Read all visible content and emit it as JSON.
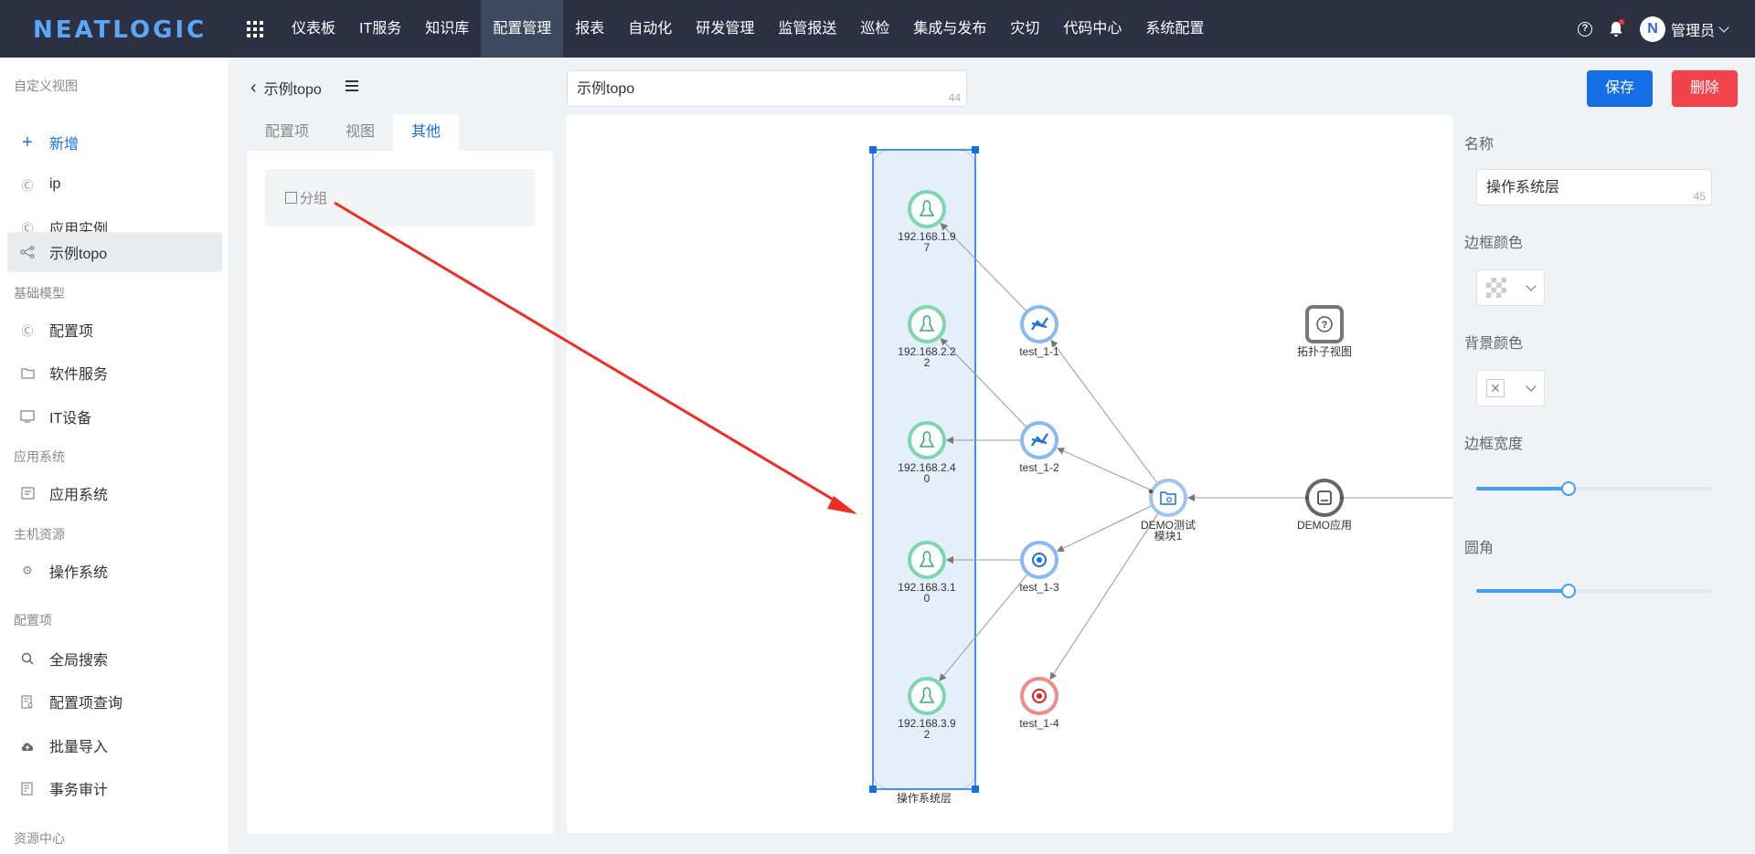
{
  "app": {
    "logo": "NEATLOGIC"
  },
  "nav": [
    "仪表板",
    "IT服务",
    "知识库",
    "配置管理",
    "报表",
    "自动化",
    "研发管理",
    "监管报送",
    "巡检",
    "集成与发布",
    "灾切",
    "代码中心",
    "系统配置"
  ],
  "nav_active": 3,
  "user": {
    "name": "管理员",
    "avatar_letter": "N"
  },
  "sidebar": {
    "groups": [
      "自定义视图",
      "基础模型",
      "应用系统",
      "主机资源",
      "配置项",
      "资源中心"
    ],
    "items": [
      {
        "label": "新增",
        "icon": "plus-icon"
      },
      {
        "label": "ip",
        "icon": "ci-icon"
      },
      {
        "label": "应用实例",
        "icon": "ci-icon"
      },
      {
        "label": "示例topo",
        "icon": "topo-icon"
      },
      {
        "label": "配置项",
        "icon": "ci-icon"
      },
      {
        "label": "软件服务",
        "icon": "folder-icon"
      },
      {
        "label": "IT设备",
        "icon": "device-icon"
      },
      {
        "label": "应用系统",
        "icon": "app-icon"
      },
      {
        "label": "操作系统",
        "icon": "gear-icon"
      },
      {
        "label": "全局搜索",
        "icon": "search-icon"
      },
      {
        "label": "配置项查询",
        "icon": "query-icon"
      },
      {
        "label": "批量导入",
        "icon": "cloud-upload-icon"
      },
      {
        "label": "事务审计",
        "icon": "audit-icon"
      }
    ]
  },
  "breadcrumb": {
    "back": "‹",
    "title": "示例topo"
  },
  "tabs": [
    "配置项",
    "视图",
    "其他"
  ],
  "tab_active": 2,
  "group_option": "分组",
  "view_name": {
    "value": "示例topo",
    "count": "44"
  },
  "buttons": {
    "save": "保存",
    "delete": "删除"
  },
  "topology": {
    "group_label": "操作系统层",
    "nodes": [
      {
        "id": "os1",
        "label": [
          "192.168.1.9",
          "7"
        ],
        "kind": "linux"
      },
      {
        "id": "os2",
        "label": [
          "192.168.2.2",
          "2"
        ],
        "kind": "linux"
      },
      {
        "id": "os3",
        "label": [
          "192.168.2.4",
          "0"
        ],
        "kind": "linux"
      },
      {
        "id": "os4",
        "label": [
          "192.168.3.1",
          "0"
        ],
        "kind": "linux"
      },
      {
        "id": "os5",
        "label": [
          "192.168.3.9",
          "2"
        ],
        "kind": "linux"
      },
      {
        "id": "t11",
        "label": [
          "test_1-1"
        ],
        "kind": "instance"
      },
      {
        "id": "t12",
        "label": [
          "test_1-2"
        ],
        "kind": "instance"
      },
      {
        "id": "t13",
        "label": [
          "test_1-3"
        ],
        "kind": "instance2"
      },
      {
        "id": "t14",
        "label": [
          "test_1-4"
        ],
        "kind": "alert"
      },
      {
        "id": "mod",
        "label": [
          "DEMO测试",
          "模块1"
        ],
        "kind": "module"
      },
      {
        "id": "app",
        "label": [
          "DEMO应用"
        ],
        "kind": "app"
      },
      {
        "id": "sub",
        "label": [
          "拓扑子视图"
        ],
        "kind": "subview"
      }
    ],
    "edges": [
      [
        "t11",
        "os1"
      ],
      [
        "t12",
        "os2"
      ],
      [
        "t12",
        "os3"
      ],
      [
        "t13",
        "os4"
      ],
      [
        "t13",
        "os5"
      ],
      [
        "mod",
        "t11"
      ],
      [
        "mod",
        "t12"
      ],
      [
        "mod",
        "t13"
      ],
      [
        "mod",
        "t14"
      ],
      [
        "app",
        "mod"
      ]
    ]
  },
  "props": {
    "name_label": "名称",
    "name_value": "操作系统层",
    "name_count": "45",
    "border_color_label": "边框颜色",
    "bg_color_label": "背景颜色",
    "bg_color_none": "✕",
    "border_width_label": "边框宽度",
    "border_width_level": 0.39,
    "radius_label": "圆角",
    "radius_level": 0.39
  },
  "colors": {
    "accent": "#1670e5",
    "danger": "#f0434a",
    "topbar": "#2d3043",
    "linux": "#7fd6ad",
    "instance": "#8ab9f1",
    "alert": "#ef8b8b",
    "annotation_arrow": "#f22b22"
  }
}
